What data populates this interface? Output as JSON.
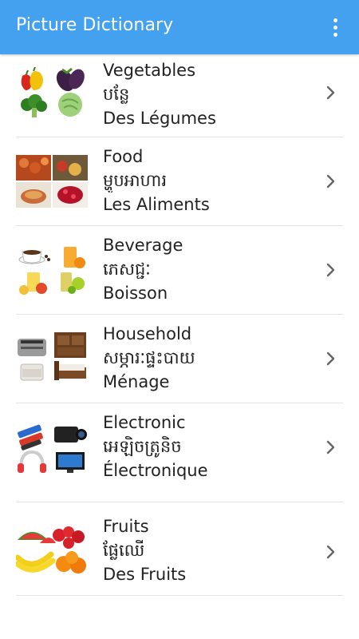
{
  "app": {
    "title": "Picture Dictionary",
    "colors": {
      "appbar": "#43A1F0",
      "text": "#222222",
      "divider": "#e3e3e3",
      "chevron": "#666666"
    }
  },
  "toolbar": {
    "overflow_icon": "more-vert-icon"
  },
  "categories": [
    {
      "english": "Vegetables",
      "khmer": "បន្លែ",
      "french": "Des Légumes",
      "icon": "chevron-right-icon"
    },
    {
      "english": "Food",
      "khmer": "ម្ហូបអាហារ",
      "french": "Les Aliments",
      "icon": "chevron-right-icon"
    },
    {
      "english": "Beverage",
      "khmer": "ភេសជ្ជៈ",
      "french": "Boisson",
      "icon": "chevron-right-icon"
    },
    {
      "english": "Household",
      "khmer": "សម្ភារៈផ្ទះបាយ",
      "french": "Ménage",
      "icon": "chevron-right-icon"
    },
    {
      "english": "Electronic",
      "khmer": "អេឡិចត្រូនិច",
      "french": "Électronique",
      "icon": "chevron-right-icon"
    },
    {
      "english": "Fruits",
      "khmer": "ផ្លែឈើ",
      "french": "Des Fruits",
      "icon": "chevron-right-icon"
    }
  ]
}
